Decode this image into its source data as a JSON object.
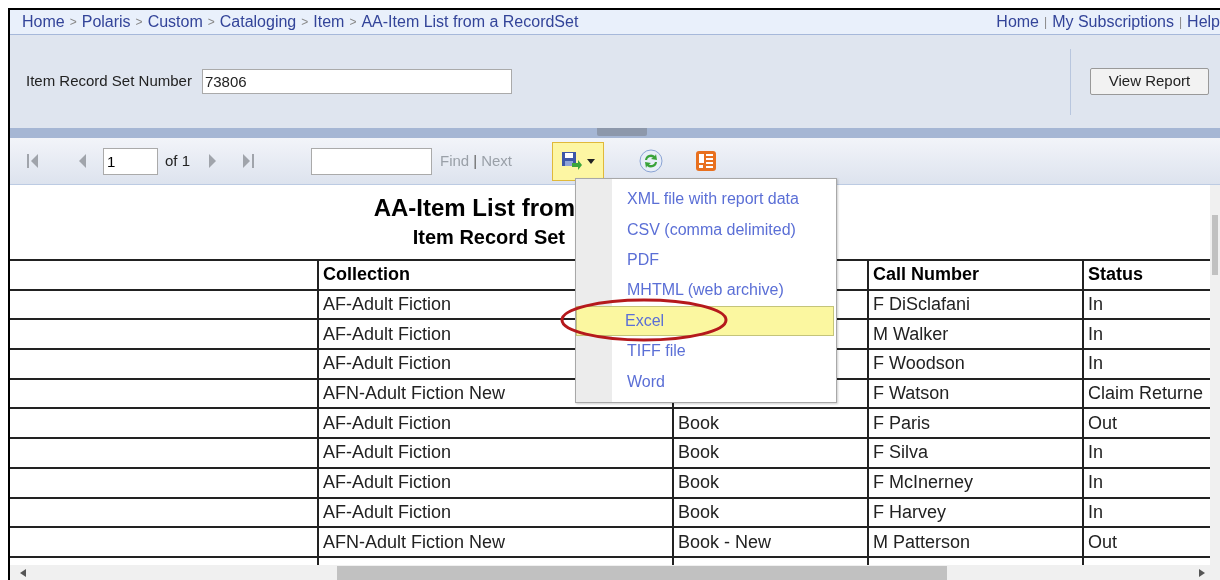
{
  "breadcrumb": {
    "separator": ">",
    "items": [
      "Home",
      "Polaris",
      "Custom",
      "Cataloging",
      "Item",
      "AA-Item List from a RecordSet"
    ]
  },
  "top_links": {
    "separator": "|",
    "items": [
      "Home",
      "My Subscriptions",
      "Help"
    ]
  },
  "parameters": {
    "label": "Item Record Set Number",
    "value": "73806",
    "button": "View Report"
  },
  "toolbar": {
    "nav": [
      {
        "kind": "first",
        "disabled": true
      },
      {
        "kind": "previous",
        "disabled": true
      }
    ],
    "page": "1",
    "of_label": "of 1",
    "nav_after": [
      {
        "kind": "next",
        "disabled": true
      },
      {
        "kind": "last",
        "disabled": true
      }
    ],
    "find_label": "Find",
    "find_separator": "|",
    "next_label": "Next",
    "find_disabled": true,
    "export_open": true
  },
  "export_menu": {
    "items": [
      {
        "label": "XML file with report data",
        "selected": false
      },
      {
        "label": "CSV (comma delimited)",
        "selected": false
      },
      {
        "label": "PDF",
        "selected": false
      },
      {
        "label": "MHTML (web archive)",
        "selected": false
      },
      {
        "label": "Excel",
        "selected": true
      },
      {
        "label": "TIFF file",
        "selected": false
      },
      {
        "label": "Word",
        "selected": false
      }
    ],
    "annotated": true
  },
  "report": {
    "title": "AA-Item List from",
    "subtitle": "Item Record Set",
    "columns": {
      "collection": "Collection",
      "call_number": "Call Number",
      "status": "Status"
    },
    "rows": [
      {
        "collection": "AF-Adult Fiction",
        "call_number": "F DiSclafani",
        "status": "In"
      },
      {
        "collection": "AF-Adult Fiction",
        "call_number": "M Walker",
        "status": "In"
      },
      {
        "collection": "AF-Adult Fiction",
        "call_number": "F Woodson",
        "status": "In"
      },
      {
        "collection": "AFN-Adult Fiction New",
        "call_number": "F Watson",
        "status": "Claim Returne"
      },
      {
        "collection": "AF-Adult Fiction",
        "column_3": "Book",
        "call_number": "F Paris",
        "status": "Out"
      },
      {
        "collection": "AF-Adult Fiction",
        "column_3": "Book",
        "call_number": "F Silva",
        "status": "In"
      },
      {
        "collection": "AF-Adult Fiction",
        "column_3": "Book",
        "call_number": "F McInerney",
        "status": "In"
      },
      {
        "collection": "AF-Adult Fiction",
        "column_3": "Book",
        "call_number": "F Harvey",
        "status": "In"
      },
      {
        "collection": "AFN-Adult Fiction New",
        "column_3": "Book - New",
        "call_number": "M Patterson",
        "status": "Out"
      }
    ]
  }
}
